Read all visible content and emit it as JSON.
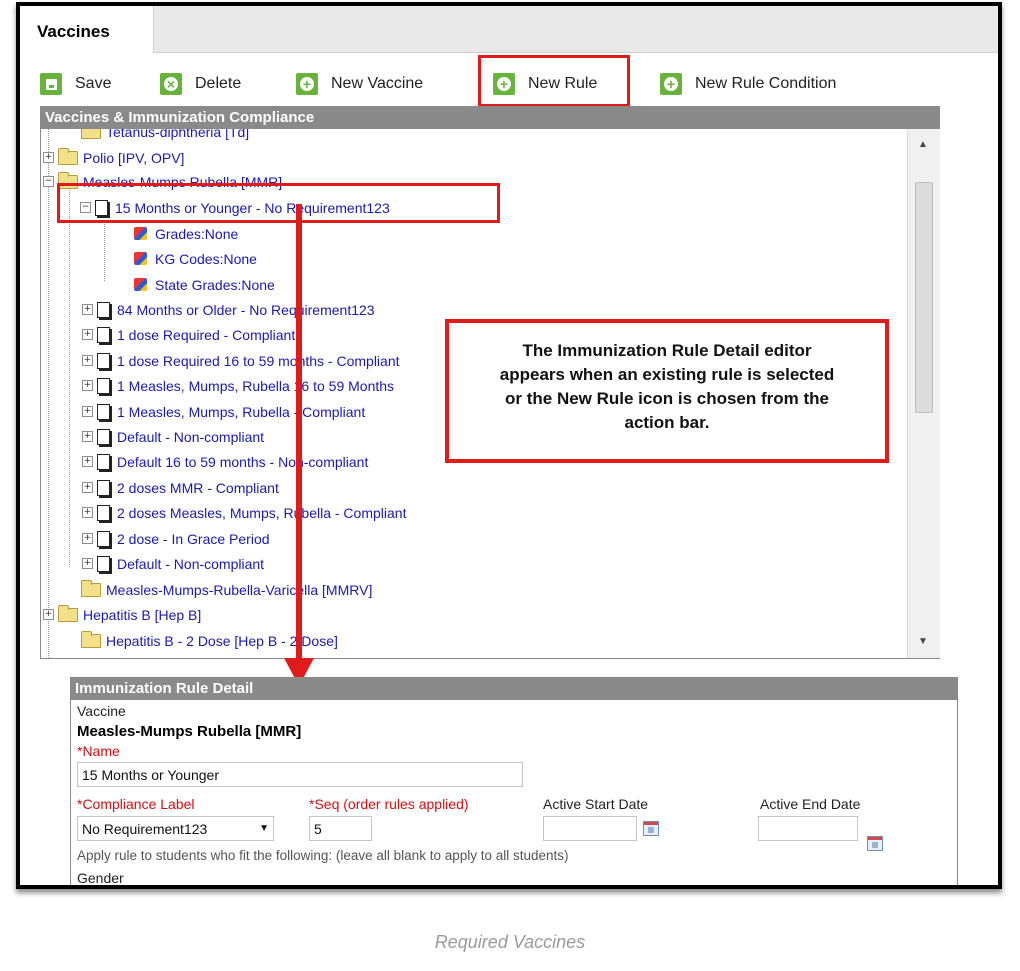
{
  "tab": {
    "label": "Vaccines"
  },
  "toolbar": {
    "save": "Save",
    "delete": "Delete",
    "new_vaccine": "New Vaccine",
    "new_rule": "New Rule",
    "new_rule_condition": "New Rule Condition"
  },
  "tree": {
    "header": "Vaccines & Immunization Compliance",
    "rows": [
      {
        "label": "Tetanus-diphtheria [Td]",
        "icon": "folder-icon"
      },
      {
        "label": "Polio [IPV, OPV]",
        "icon": "folder-icon"
      },
      {
        "label": "Measles-Mumps Rubella [MMR]",
        "icon": "folder-icon"
      },
      {
        "label": "15 Months or Younger - No Requirement123",
        "icon": "document-icon"
      },
      {
        "label": "Grades:None",
        "icon": "condition-cube-icon"
      },
      {
        "label": "KG Codes:None",
        "icon": "condition-cube-icon"
      },
      {
        "label": "State Grades:None",
        "icon": "condition-cube-icon"
      },
      {
        "label": "84 Months or Older - No Requirement123",
        "icon": "document-icon"
      },
      {
        "label": "1 dose Required - Compliant",
        "icon": "document-icon"
      },
      {
        "label": "1 dose Required 16 to 59 months - Compliant",
        "icon": "document-icon"
      },
      {
        "label": "1 Measles, Mumps, Rubella 16 to 59 Months",
        "icon": "document-icon"
      },
      {
        "label": "1 Measles, Mumps, Rubella - Compliant",
        "icon": "document-icon"
      },
      {
        "label": "Default - Non-compliant",
        "icon": "document-icon"
      },
      {
        "label": "Default 16 to 59 months - Non-compliant",
        "icon": "document-icon"
      },
      {
        "label": "2 doses MMR - Compliant",
        "icon": "document-icon"
      },
      {
        "label": "2 doses Measles, Mumps, Rubella - Compliant",
        "icon": "document-icon"
      },
      {
        "label": "2 dose - In Grace Period",
        "icon": "document-icon"
      },
      {
        "label": "Default - Non-compliant",
        "icon": "document-icon"
      },
      {
        "label": "Measles-Mumps-Rubella-Varicella [MMRV]",
        "icon": "folder-icon"
      },
      {
        "label": "Hepatitis B [Hep B]",
        "icon": "folder-icon"
      },
      {
        "label": "Hepatitis B - 2 Dose [Hep B - 2 Dose]",
        "icon": "folder-icon"
      }
    ]
  },
  "callout": {
    "line1": "The Immunization Rule Detail editor",
    "line2": "appears when an existing rule is selected",
    "line3": "or the New Rule icon is chosen from the",
    "line4": "action bar."
  },
  "detail": {
    "header": "Immunization Rule Detail",
    "vaccine_label": "Vaccine",
    "vaccine_value": "Measles-Mumps Rubella [MMR]",
    "name_label": "*Name",
    "name_value": "15 Months or Younger",
    "compliance_label": "*Compliance Label",
    "compliance_value": "No Requirement123",
    "seq_label": "*Seq (order rules applied)",
    "seq_value": "5",
    "start_date_label": "Active Start Date",
    "start_date_value": "",
    "end_date_label": "Active End Date",
    "end_date_value": "",
    "apply_text": "Apply rule to students who fit the following: (leave all blank to apply to all students)",
    "gender_label": "Gender"
  },
  "caption": "Required Vaccines",
  "colors": {
    "accent_red": "#e11a1a",
    "button_green": "#68b33a",
    "link_blue": "#1a1ab0",
    "header_gray": "#8a8a8a"
  }
}
